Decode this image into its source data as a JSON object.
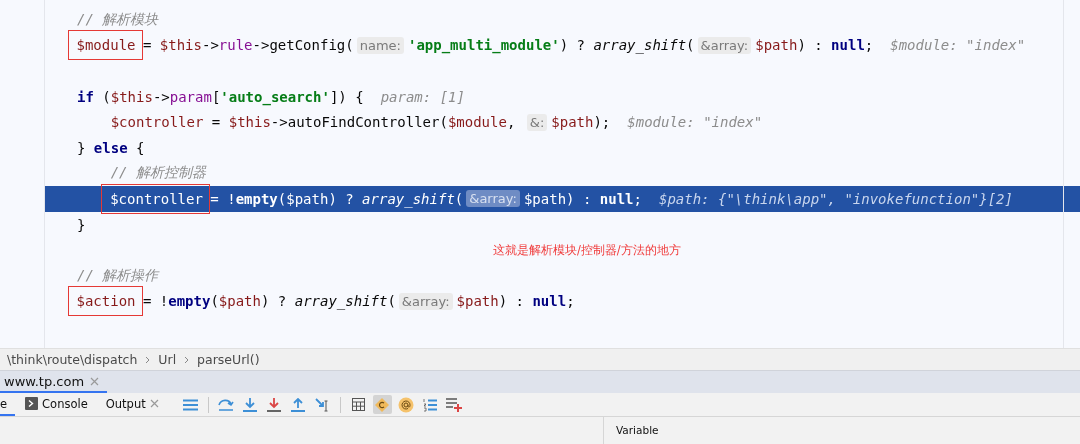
{
  "editor": {
    "lines": [
      {
        "kind": "code",
        "indented": false,
        "current": false,
        "tokens": [
          {
            "t": "// 解析模块",
            "kind": "comment"
          }
        ]
      },
      {
        "kind": "code",
        "indented": false,
        "current": false,
        "tokens": [
          {
            "t": "$module",
            "kind": "boxed"
          },
          {
            "t": " = ",
            "kind": "plain"
          },
          {
            "t": "$this",
            "kind": "var"
          },
          {
            "t": "->",
            "kind": "plain"
          },
          {
            "t": "rule",
            "kind": "field"
          },
          {
            "t": "->getConfig(",
            "kind": "plain"
          },
          {
            "t": "name:",
            "kind": "hint"
          },
          {
            "t": "'app_multi_module'",
            "kind": "string"
          },
          {
            "t": ") ? ",
            "kind": "plain"
          },
          {
            "t": "array_shift",
            "kind": "func"
          },
          {
            "t": "(",
            "kind": "plain"
          },
          {
            "t": "&array:",
            "kind": "hint"
          },
          {
            "t": "$path",
            "kind": "var"
          },
          {
            "t": ") : ",
            "kind": "plain"
          },
          {
            "t": "null",
            "kind": "keyword"
          },
          {
            "t": ";",
            "kind": "plain"
          },
          {
            "t": "$module: \"index\"",
            "kind": "value"
          }
        ]
      },
      {
        "kind": "blank"
      },
      {
        "kind": "code",
        "indented": false,
        "current": false,
        "tokens": [
          {
            "t": "if",
            "kind": "keyword"
          },
          {
            "t": " (",
            "kind": "plain"
          },
          {
            "t": "$this",
            "kind": "var"
          },
          {
            "t": "->",
            "kind": "plain"
          },
          {
            "t": "param",
            "kind": "field"
          },
          {
            "t": "[",
            "kind": "plain"
          },
          {
            "t": "'auto_search'",
            "kind": "string"
          },
          {
            "t": "]) {",
            "kind": "plain"
          },
          {
            "t": "param: [1]",
            "kind": "value"
          }
        ]
      },
      {
        "kind": "code",
        "indented": true,
        "current": false,
        "tokens": [
          {
            "t": "$controller",
            "kind": "var"
          },
          {
            "t": " = ",
            "kind": "plain"
          },
          {
            "t": "$this",
            "kind": "var"
          },
          {
            "t": "->autoFindController(",
            "kind": "plain"
          },
          {
            "t": "$module",
            "kind": "var"
          },
          {
            "t": ", ",
            "kind": "plain"
          },
          {
            "t": "&:",
            "kind": "hint"
          },
          {
            "t": "$path",
            "kind": "var"
          },
          {
            "t": ");",
            "kind": "plain"
          },
          {
            "t": "$module: \"index\"",
            "kind": "value"
          }
        ]
      },
      {
        "kind": "code",
        "indented": false,
        "current": false,
        "tokens": [
          {
            "t": "} ",
            "kind": "plain"
          },
          {
            "t": "else",
            "kind": "keyword"
          },
          {
            "t": " {",
            "kind": "plain"
          }
        ]
      },
      {
        "kind": "code",
        "indented": true,
        "current": false,
        "tokens": [
          {
            "t": "// 解析控制器",
            "kind": "comment"
          }
        ]
      },
      {
        "kind": "code",
        "indented": true,
        "current": true,
        "tokens": [
          {
            "t": "$controller",
            "kind": "boxed"
          },
          {
            "t": " = !",
            "kind": "plain"
          },
          {
            "t": "empty",
            "kind": "keyword"
          },
          {
            "t": "(",
            "kind": "plain"
          },
          {
            "t": "$path",
            "kind": "var"
          },
          {
            "t": ") ? ",
            "kind": "plain"
          },
          {
            "t": "array_shift",
            "kind": "func"
          },
          {
            "t": "(",
            "kind": "plain"
          },
          {
            "t": "&array:",
            "kind": "hint"
          },
          {
            "t": "$path",
            "kind": "var"
          },
          {
            "t": ") : ",
            "kind": "plain"
          },
          {
            "t": "null",
            "kind": "keyword"
          },
          {
            "t": ";",
            "kind": "plain"
          },
          {
            "t": "$path: {\"\\think\\app\", \"invokefunction\"}[2]",
            "kind": "value"
          }
        ]
      },
      {
        "kind": "code",
        "indented": false,
        "current": false,
        "tokens": [
          {
            "t": "}",
            "kind": "plain"
          }
        ]
      },
      {
        "kind": "note",
        "text": "这就是解析模块/控制器/方法的地方"
      },
      {
        "kind": "code",
        "indented": false,
        "current": false,
        "tokens": [
          {
            "t": "// 解析操作",
            "kind": "comment"
          }
        ]
      },
      {
        "kind": "code",
        "indented": false,
        "current": false,
        "tokens": [
          {
            "t": "$action",
            "kind": "boxed"
          },
          {
            "t": " = !",
            "kind": "plain"
          },
          {
            "t": "empty",
            "kind": "keyword"
          },
          {
            "t": "(",
            "kind": "plain"
          },
          {
            "t": "$path",
            "kind": "var"
          },
          {
            "t": ") ? ",
            "kind": "plain"
          },
          {
            "t": "array_shift",
            "kind": "func"
          },
          {
            "t": "(",
            "kind": "plain"
          },
          {
            "t": "&array:",
            "kind": "hint"
          },
          {
            "t": "$path",
            "kind": "var"
          },
          {
            "t": ") : ",
            "kind": "plain"
          },
          {
            "t": "null",
            "kind": "keyword"
          },
          {
            "t": ";",
            "kind": "plain"
          }
        ]
      }
    ]
  },
  "breadcrumb": [
    "\\think\\route\\dispatch",
    "Url",
    "parseUrl()"
  ],
  "session_tab": {
    "label": "www.tp.com",
    "selected": true
  },
  "debug_tabs": [
    {
      "label": "e",
      "selected": true,
      "kind": "plain"
    },
    {
      "label": "Console",
      "selected": false,
      "kind": "console"
    },
    {
      "label": "Output",
      "selected": false,
      "kind": "closable"
    }
  ],
  "toolbar": [
    {
      "kind": "menu",
      "on": false
    },
    {
      "kind": "sep"
    },
    {
      "kind": "step-over",
      "on": false
    },
    {
      "kind": "step-into",
      "on": false
    },
    {
      "kind": "force-step-into",
      "on": false
    },
    {
      "kind": "step-out",
      "on": false
    },
    {
      "kind": "run-to-cursor",
      "on": false
    },
    {
      "kind": "sep"
    },
    {
      "kind": "calculator",
      "on": false
    },
    {
      "kind": "class",
      "on": true
    },
    {
      "kind": "at",
      "on": false
    },
    {
      "kind": "numbered-list",
      "on": false
    },
    {
      "kind": "add-list",
      "on": false
    }
  ],
  "variables_header": "Variable"
}
